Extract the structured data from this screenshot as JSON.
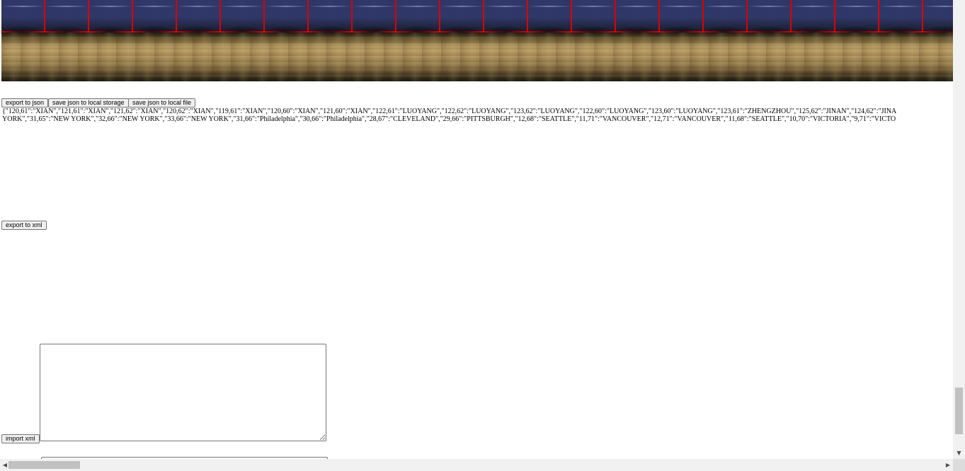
{
  "toolbar": {
    "export_json_label": "export to json",
    "save_local_storage_label": "save json to local storage",
    "save_local_file_label": "save json to local file",
    "export_xml_label": "export to xml",
    "import_xml_label": "import xml"
  },
  "json_output": {
    "line1": "{\"120,61\":\"XIAN\",\"121,61\":\"XIAN\",\"121,62\":\"XIAN\",\"120,62\":\"XIAN\",\"119,61\":\"XIAN\",\"120,60\":\"XIAN\",\"121,60\":\"XIAN\",\"122,61\":\"LUOYANG\",\"122,62\":\"LUOYANG\",\"123,62\":\"LUOYANG\",\"122,60\":\"LUOYANG\",\"123,60\":\"LUOYANG\",\"123,61\":\"ZHENGZHOU\",\"125,62\":\"JINAN\",\"124,62\":\"JINA",
    "line2": "YORK\",\"31,65\":\"NEW YORK\",\"32,66\":\"NEW YORK\",\"33,66\":\"NEW YORK\",\"31,66\":\"Philadelphia\",\"30,66\":\"Philadelphia\",\"28,67\":\"CLEVELAND\",\"29,66\":\"PITTSBURGH\",\"12,68\":\"SEATTLE\",\"11,71\":\"VANCOUVER\",\"12,71\":\"VANCOUVER\",\"11,68\":\"SEATTLE\",\"10,70\":\"VICTORIA\",\"9,71\":\"VICTO"
  },
  "xml_input": {
    "value": ""
  },
  "scrollbars": {
    "up_arrow": "▲",
    "down_arrow": "▼",
    "left_arrow": "◀",
    "right_arrow": "▶"
  },
  "map": {
    "sea_color": "#2f3768",
    "grid_line_color": "#e00000",
    "ground_color": "#a58a55"
  }
}
